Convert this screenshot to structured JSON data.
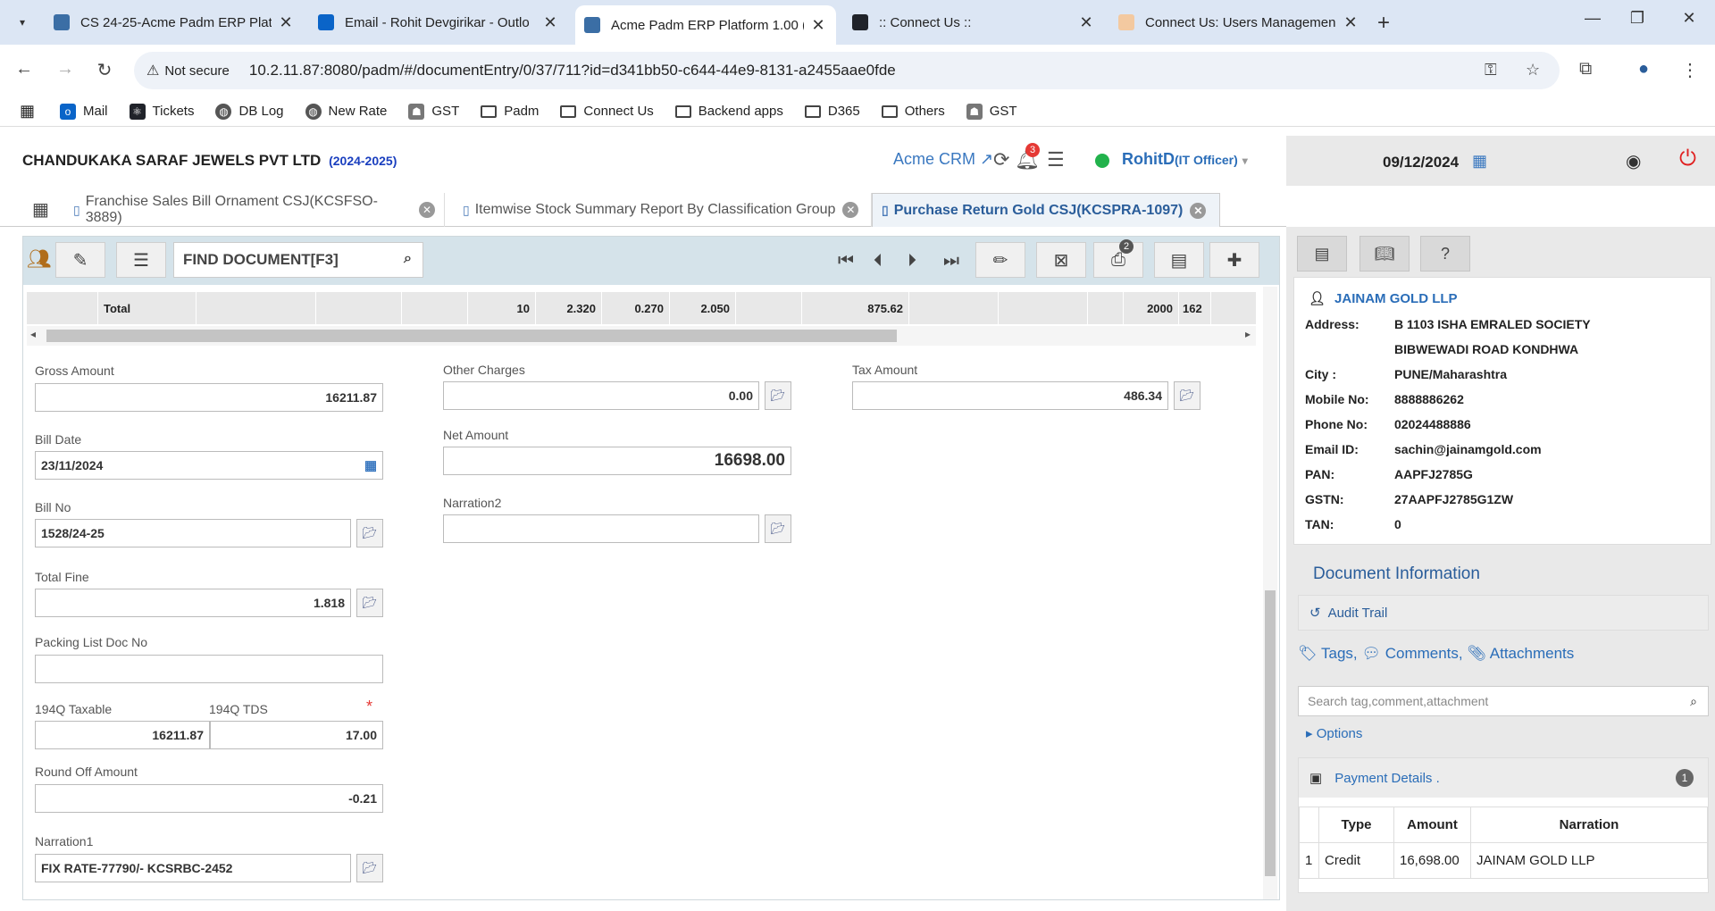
{
  "browser": {
    "tabs": [
      {
        "title": "CS 24-25-Acme Padm ERP Platf",
        "active": false
      },
      {
        "title": "Email - Rohit Devgirikar - Outlo",
        "active": false
      },
      {
        "title": "Acme Padm ERP Platform 1.00 (",
        "active": true
      },
      {
        "title": ":: Connect Us ::",
        "active": false
      },
      {
        "title": "Connect Us: Users Managemen",
        "active": false
      }
    ],
    "security_label": "Not secure",
    "url": "10.2.11.87:8080/padm/#/documentEntry/0/37/711?id=d341bb50-c644-44e9-8131-a2455aae0fde",
    "bookmarks": [
      "Mail",
      "Tickets",
      "DB Log",
      "New Rate",
      "GST",
      "Padm",
      "Connect Us",
      "Backend apps",
      "D365",
      "Others",
      "GST"
    ]
  },
  "header": {
    "company": "CHANDUKAKA SARAF JEWELS PVT LTD",
    "year": "(2024-2025)",
    "crm_link": "Acme CRM",
    "notification_count": "3",
    "user": "RohitD",
    "role": "(IT Officer)",
    "date": "09/12/2024"
  },
  "doc_tabs": [
    {
      "label": "Franchise Sales Bill Ornament CSJ(KCSFSO-3889)",
      "active": false
    },
    {
      "label": "Itemwise Stock Summary Report By Classification Group",
      "active": false
    },
    {
      "label": "Purchase Return Gold CSJ(KCSPRA-1097)",
      "active": true
    }
  ],
  "form_toolbar": {
    "find_placeholder": "FIND DOCUMENT[F3]",
    "print_badge": "2"
  },
  "total_row": {
    "label": "Total",
    "cells": [
      "",
      "",
      "",
      "10",
      "2.320",
      "0.270",
      "2.050",
      "",
      "875.62",
      "",
      "",
      "",
      "2000",
      "162"
    ]
  },
  "form": {
    "gross_amount": {
      "label": "Gross Amount",
      "value": "16211.87"
    },
    "bill_date": {
      "label": "Bill Date",
      "value": "23/11/2024"
    },
    "bill_no": {
      "label": "Bill No",
      "value": "1528/24-25"
    },
    "total_fine": {
      "label": "Total Fine",
      "value": "1.818"
    },
    "packing_list": {
      "label": "Packing List Doc No",
      "value": ""
    },
    "taxable_194q": {
      "label": "194Q Taxable",
      "value": "16211.87"
    },
    "tds_194q": {
      "label": "194Q TDS",
      "value": "17.00"
    },
    "round_off": {
      "label": "Round Off Amount",
      "value": "-0.21"
    },
    "narration1": {
      "label": "Narration1",
      "value": "FIX RATE-77790/- KCSRBC-2452"
    },
    "other_charges": {
      "label": "Other Charges",
      "value": "0.00"
    },
    "net_amount": {
      "label": "Net Amount",
      "value": "16698.00"
    },
    "narration2": {
      "label": "Narration2",
      "value": ""
    },
    "tax_amount": {
      "label": "Tax Amount",
      "value": "486.34"
    }
  },
  "party": {
    "name": "JAINAM GOLD LLP",
    "rows": [
      {
        "k": "Address:",
        "v": "B 1103 ISHA EMRALED SOCIETY"
      },
      {
        "k": "",
        "v": "BIBWEWADI ROAD KONDHWA"
      },
      {
        "k": "City :",
        "v": "PUNE/Maharashtra"
      },
      {
        "k": "Mobile No:",
        "v": "8888886262"
      },
      {
        "k": "Phone No:",
        "v": "02024488886"
      },
      {
        "k": "Email ID:",
        "v": "sachin@jainamgold.com"
      },
      {
        "k": "PAN:",
        "v": "AAPFJ2785G"
      },
      {
        "k": "GSTN:",
        "v": "27AAPFJ2785G1ZW"
      },
      {
        "k": "TAN:",
        "v": "0"
      }
    ]
  },
  "doc_info": {
    "title": "Document Information",
    "audit_trail": "Audit Trail",
    "tags": "Tags,",
    "comments": "Comments,",
    "attachments": "Attachments",
    "search_placeholder": "Search tag,comment,attachment",
    "options": "Options"
  },
  "payment": {
    "title": "Payment Details .",
    "count": "1",
    "columns": [
      "",
      "Type",
      "Amount",
      "Narration"
    ],
    "rows": [
      [
        "1",
        "Credit",
        "16,698.00",
        "JAINAM GOLD LLP"
      ]
    ]
  }
}
